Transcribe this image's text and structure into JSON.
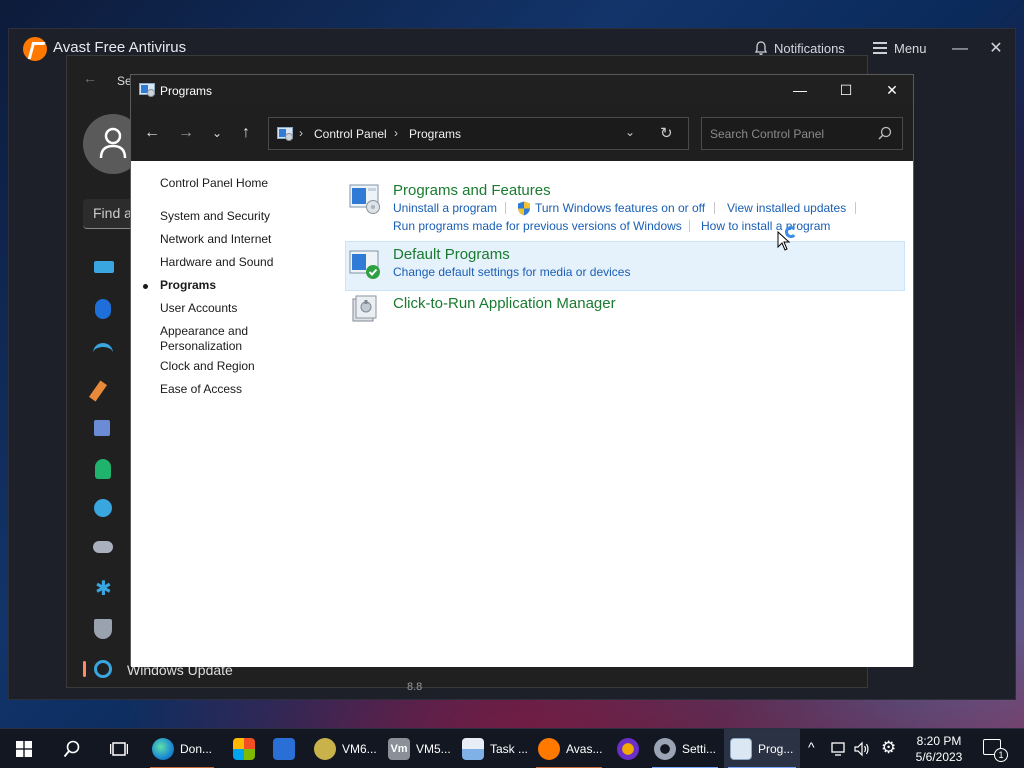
{
  "avast": {
    "title": "Avast Free Antivirus",
    "notifications_label": "Notifications",
    "menu_label": "Menu"
  },
  "settings": {
    "title_fragment": "Se",
    "find_fragment": "Find a",
    "windows_update_label": "Windows Update",
    "bottom_fragment": "8.8"
  },
  "control_panel": {
    "title": "Programs",
    "breadcrumb": [
      "Control Panel",
      "Programs"
    ],
    "search_placeholder": "Search Control Panel",
    "sidebar": {
      "home": "Control Panel Home",
      "items": [
        {
          "label": "System and Security",
          "active": false
        },
        {
          "label": "Network and Internet",
          "active": false
        },
        {
          "label": "Hardware and Sound",
          "active": false
        },
        {
          "label": "Programs",
          "active": true
        },
        {
          "label": "User Accounts",
          "active": false
        },
        {
          "label": "Appearance and",
          "active": false
        },
        {
          "label": "Personalization",
          "active": false
        },
        {
          "label": "Clock and Region",
          "active": false
        },
        {
          "label": "Ease of Access",
          "active": false
        }
      ]
    },
    "categories": {
      "programs_features": {
        "title": "Programs and Features",
        "links": [
          "Uninstall a program",
          "Turn Windows features on or off",
          "View installed updates",
          "Run programs made for previous versions of Windows",
          "How to install a program"
        ]
      },
      "default_programs": {
        "title": "Default Programs",
        "links": [
          "Change default settings for media or devices"
        ]
      },
      "click_to_run": {
        "title": "Click-to-Run Application Manager"
      }
    }
  },
  "taskbar": {
    "apps": [
      {
        "label": "Don..."
      },
      {
        "label": "VM6..."
      },
      {
        "label": "VM5..."
      },
      {
        "label": "Task ..."
      },
      {
        "label": "Avas..."
      },
      {
        "label": "Setti..."
      },
      {
        "label": "Prog..."
      }
    ],
    "time": "8:20 PM",
    "date": "5/6/2023",
    "notification_count": "1"
  },
  "colors": {
    "category_title": "#1a7a2f",
    "task_link": "#1a5fb4",
    "highlight_row": "#e5f1fb",
    "avast_orange": "#ff7800"
  }
}
